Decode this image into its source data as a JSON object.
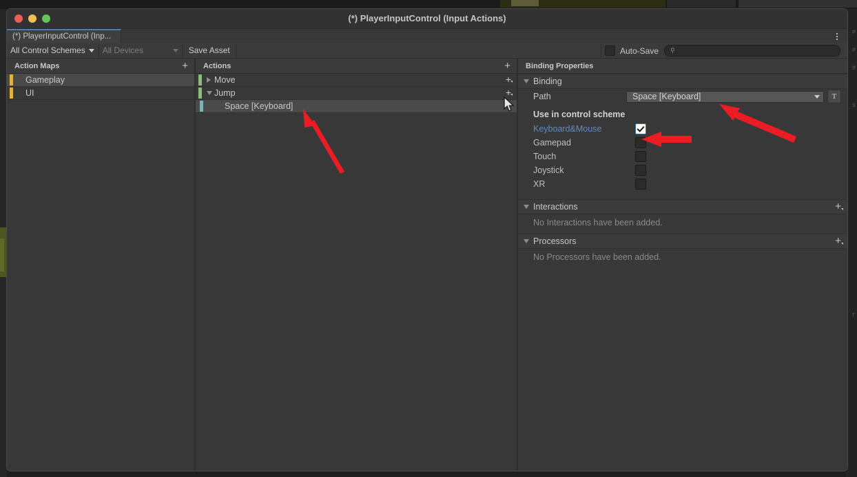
{
  "window": {
    "title": "(*) PlayerInputControl (Input Actions)",
    "traffic_lights": [
      "close-red",
      "minimize-yellow",
      "maximize-green"
    ]
  },
  "tab": {
    "label": "(*) PlayerInputControl (Inp...",
    "menu_icon": "kebab-menu-icon"
  },
  "toolbar": {
    "control_schemes": "All Control Schemes",
    "devices": "All Devices",
    "save_asset": "Save Asset",
    "auto_save_label": "Auto-Save",
    "auto_save_checked": false,
    "search_placeholder": "",
    "search_value": "",
    "search_icon": "search-icon"
  },
  "action_maps": {
    "header": "Action Maps",
    "add_icon": "plus-icon",
    "accent_color": "#e0b23c",
    "items": [
      {
        "label": "Gameplay",
        "selected": true
      },
      {
        "label": "UI",
        "selected": false
      }
    ]
  },
  "actions": {
    "header": "Actions",
    "add_icon": "plus-icon",
    "action_accent_color": "#8fba82",
    "binding_accent_color": "#7fb2b6",
    "items": [
      {
        "label": "Move",
        "expanded": false,
        "selected": false,
        "type": "action"
      },
      {
        "label": "Jump",
        "expanded": true,
        "selected": false,
        "type": "action"
      },
      {
        "label": "Space [Keyboard]",
        "selected": true,
        "type": "binding"
      }
    ]
  },
  "binding_properties": {
    "header": "Binding Properties",
    "sections": {
      "binding": {
        "title": "Binding",
        "path_label": "Path",
        "path_value": "Space [Keyboard]",
        "path_dropdown_icon": "chevron-down-icon",
        "t_button_label": "T",
        "control_scheme_title": "Use in control scheme",
        "schemes": [
          {
            "name": "Keyboard&Mouse",
            "checked": true,
            "highlighted": true
          },
          {
            "name": "Gamepad",
            "checked": false,
            "highlighted": false
          },
          {
            "name": "Touch",
            "checked": false,
            "highlighted": false
          },
          {
            "name": "Joystick",
            "checked": false,
            "highlighted": false
          },
          {
            "name": "XR",
            "checked": false,
            "highlighted": false
          }
        ]
      },
      "interactions": {
        "title": "Interactions",
        "add_icon": "plus-dropdown-icon",
        "empty_text": "No Interactions have been added."
      },
      "processors": {
        "title": "Processors",
        "add_icon": "plus-dropdown-icon",
        "empty_text": "No Processors have been added."
      }
    }
  },
  "annotations": {
    "arrow_color": "#ec1c24",
    "arrows": [
      {
        "name": "arrow-to-space-binding"
      },
      {
        "name": "arrow-to-keyboard-mouse-checkbox"
      },
      {
        "name": "arrow-to-path-field"
      }
    ]
  },
  "background": {
    "code_marks": [
      "#",
      "#",
      "#",
      "s",
      "r"
    ]
  }
}
